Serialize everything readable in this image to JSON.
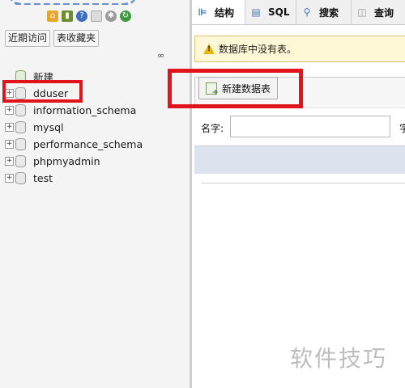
{
  "nav": {
    "icons": [
      "home-icon",
      "logout-icon",
      "help-icon",
      "docs-icon",
      "settings-icon",
      "reload-icon"
    ],
    "tabs": [
      "近期访问",
      "表收藏夹"
    ],
    "tree": [
      {
        "label": "新建",
        "expander": ""
      },
      {
        "label": "dduser",
        "expander": "+"
      },
      {
        "label": "information_schema",
        "expander": "+"
      },
      {
        "label": "mysql",
        "expander": "+"
      },
      {
        "label": "performance_schema",
        "expander": "+"
      },
      {
        "label": "phpmyadmin",
        "expander": "+"
      },
      {
        "label": "test",
        "expander": "+"
      }
    ]
  },
  "main": {
    "tabs": [
      {
        "label": "结构",
        "icon": "structure-icon"
      },
      {
        "label": "SQL",
        "icon": "sql-icon"
      },
      {
        "label": "搜索",
        "icon": "search-icon"
      },
      {
        "label": "查询",
        "icon": "query-icon"
      }
    ],
    "notice": "数据库中没有表。",
    "create_table_label": "新建数据表",
    "name_label": "名字:",
    "columns_label_partial": "字"
  },
  "colors": {
    "highlight": "#e1141b",
    "notice_bg": "#fff8d7",
    "footer_bg": "#dde3ee"
  },
  "watermark": "软件技巧"
}
